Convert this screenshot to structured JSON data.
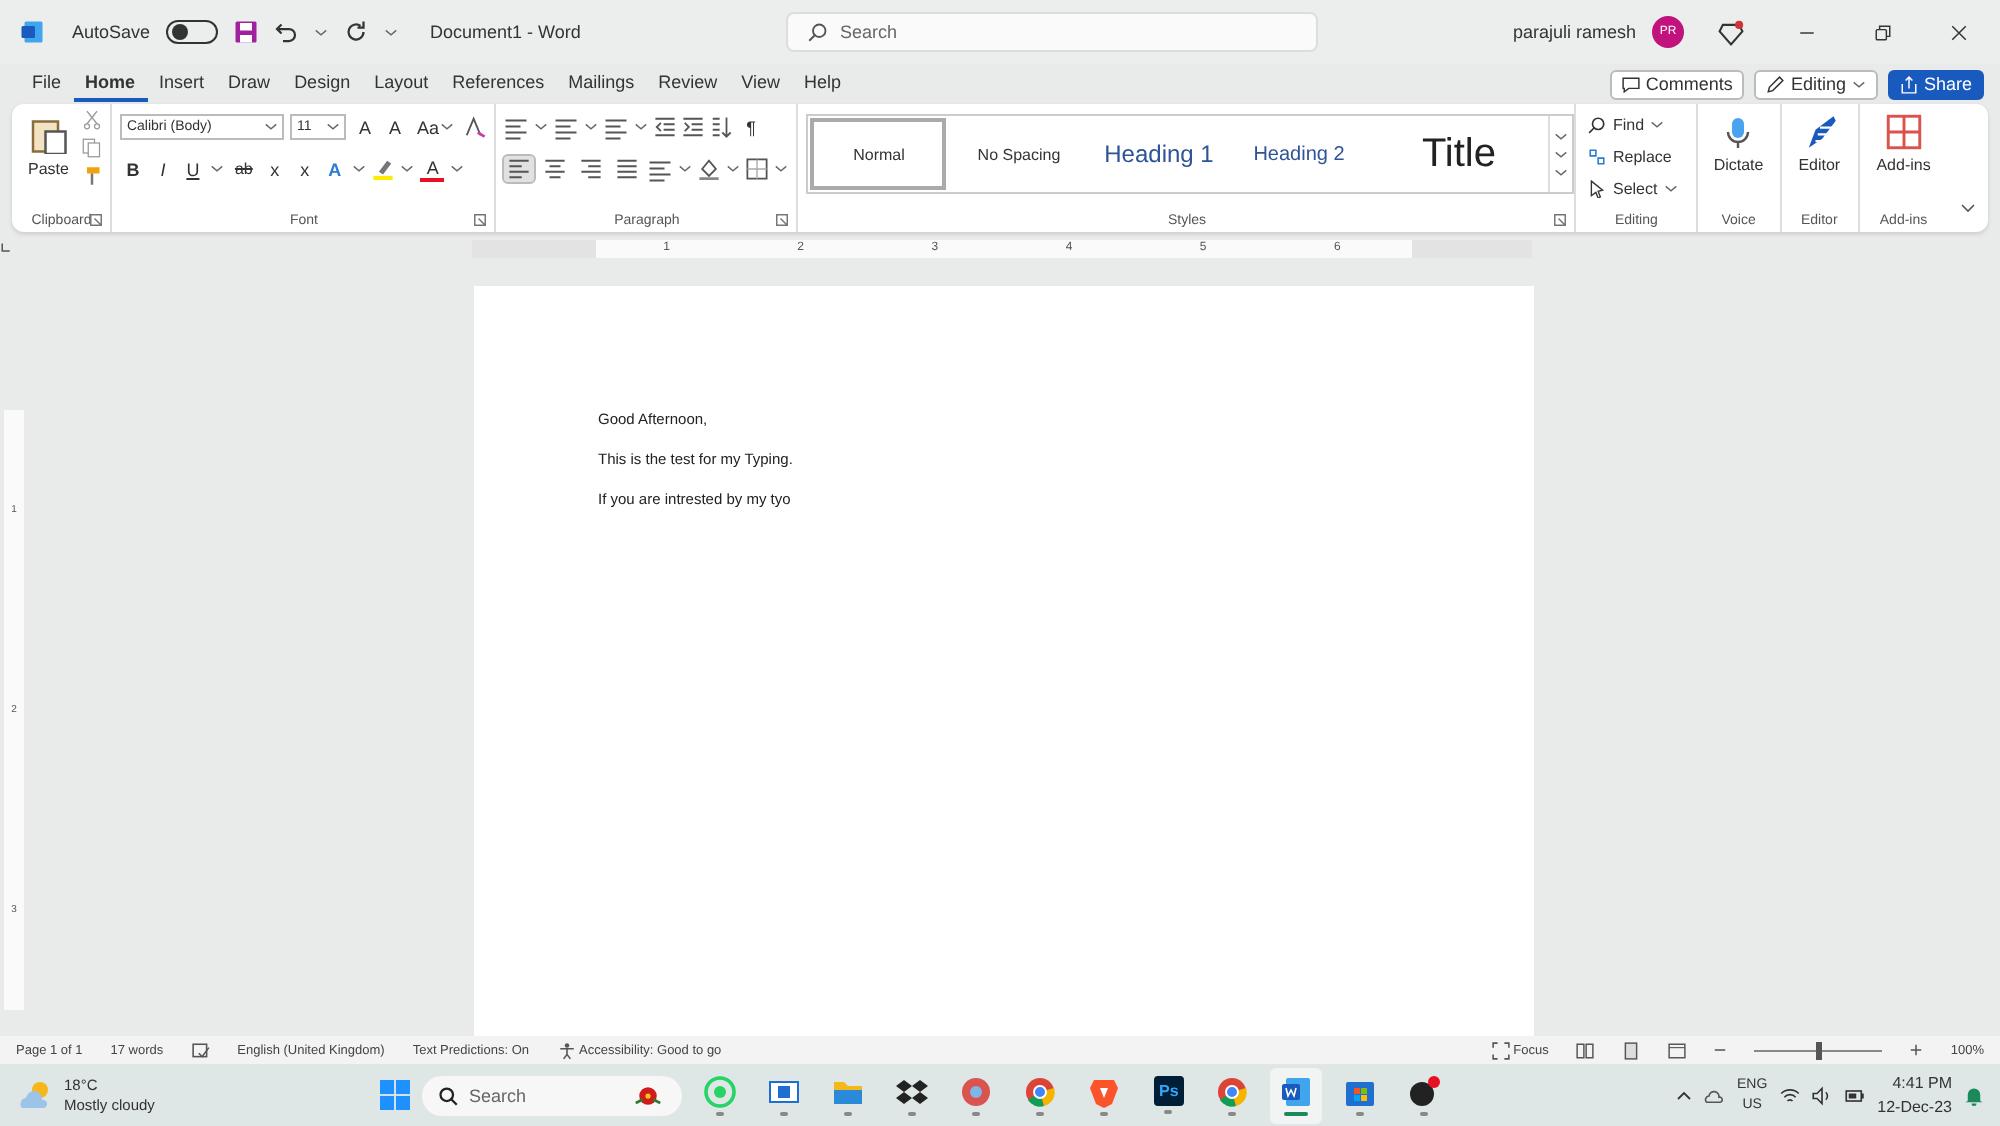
{
  "title_bar": {
    "autosave_label": "AutoSave",
    "autosave_on": false,
    "document_title": "Document1 - Word",
    "search_placeholder": "Search",
    "user_name": "parajuli ramesh",
    "avatar_initials": "PR"
  },
  "menu_tabs": [
    {
      "label": "File",
      "selected": false
    },
    {
      "label": "Home",
      "selected": true
    },
    {
      "label": "Insert",
      "selected": false
    },
    {
      "label": "Draw",
      "selected": false
    },
    {
      "label": "Design",
      "selected": false
    },
    {
      "label": "Layout",
      "selected": false
    },
    {
      "label": "References",
      "selected": false
    },
    {
      "label": "Mailings",
      "selected": false
    },
    {
      "label": "Review",
      "selected": false
    },
    {
      "label": "View",
      "selected": false
    },
    {
      "label": "Help",
      "selected": false
    }
  ],
  "actions": {
    "comments": "Comments",
    "editing": "Editing",
    "share": "Share"
  },
  "ribbon": {
    "clipboard": {
      "paste": "Paste",
      "label": "Clipboard"
    },
    "font": {
      "name": "Calibri (Body)",
      "size": "11",
      "grow": "A",
      "shrink": "A",
      "case": "Aa",
      "bold": "B",
      "italic": "I",
      "underline": "U",
      "strike": "ab",
      "subscript": "x",
      "superscript": "x",
      "effects": "A",
      "font_color_letter": "A",
      "label": "Font"
    },
    "paragraph": {
      "show_marks": "¶",
      "align_buttons": [
        {
          "kind": "left",
          "selected": true
        },
        {
          "kind": "center",
          "selected": false
        },
        {
          "kind": "right",
          "selected": false
        },
        {
          "kind": "justify",
          "selected": false
        }
      ],
      "label": "Paragraph"
    },
    "styles": {
      "items": [
        {
          "label": "Normal",
          "kind": "normal",
          "selected": true
        },
        {
          "label": "No Spacing",
          "kind": "normal",
          "selected": false
        },
        {
          "label": "Heading 1",
          "kind": "heading1",
          "selected": false
        },
        {
          "label": "Heading 2",
          "kind": "heading2",
          "selected": false
        },
        {
          "label": "Title",
          "kind": "title",
          "selected": false
        }
      ],
      "label": "Styles"
    },
    "editing": {
      "find": "Find",
      "replace": "Replace",
      "select": "Select",
      "label": "Editing"
    },
    "voice": {
      "button": "Dictate",
      "label": "Voice"
    },
    "editor": {
      "button": "Editor",
      "label": "Editor"
    },
    "addins": {
      "button": "Add-ins",
      "label": "Add-ins"
    }
  },
  "ruler": {
    "ticks": [
      "1",
      "2",
      "3",
      "4",
      "5",
      "6"
    ]
  },
  "vertical_ruler": {
    "ticks": [
      "1",
      "2",
      "3"
    ]
  },
  "document": {
    "paragraphs": [
      "Good Afternoon,",
      "This is the test for my Typing.",
      "If you are intrested by my tyo"
    ]
  },
  "status_bar": {
    "page": "Page 1 of 1",
    "words": "17 words",
    "language": "English (United Kingdom)",
    "predictions": "Text Predictions: On",
    "accessibility": "Accessibility: Good to go",
    "focus": "Focus",
    "zoom": {
      "level": 0.5,
      "reading": "100%"
    }
  },
  "taskbar": {
    "temperature": "18°C",
    "condition": "Mostly cloudy",
    "search_placeholder": "Search",
    "apps": [
      {
        "kind": "whatsapp",
        "selected": false
      },
      {
        "kind": "window",
        "selected": false
      },
      {
        "kind": "folder",
        "selected": false
      },
      {
        "kind": "dropbox",
        "selected": false
      },
      {
        "kind": "redball",
        "selected": false
      },
      {
        "kind": "chrome",
        "selected": false
      },
      {
        "kind": "brave",
        "selected": false
      },
      {
        "kind": "photoshop",
        "label": "Ps",
        "selected": false
      },
      {
        "kind": "chrome",
        "selected": false
      },
      {
        "kind": "word",
        "selected": true
      },
      {
        "kind": "store",
        "selected": false
      },
      {
        "kind": "dark",
        "selected": false
      }
    ],
    "language_top": "ENG",
    "language_bottom": "US",
    "time": "4:41 PM",
    "date": "12-Dec-23"
  }
}
